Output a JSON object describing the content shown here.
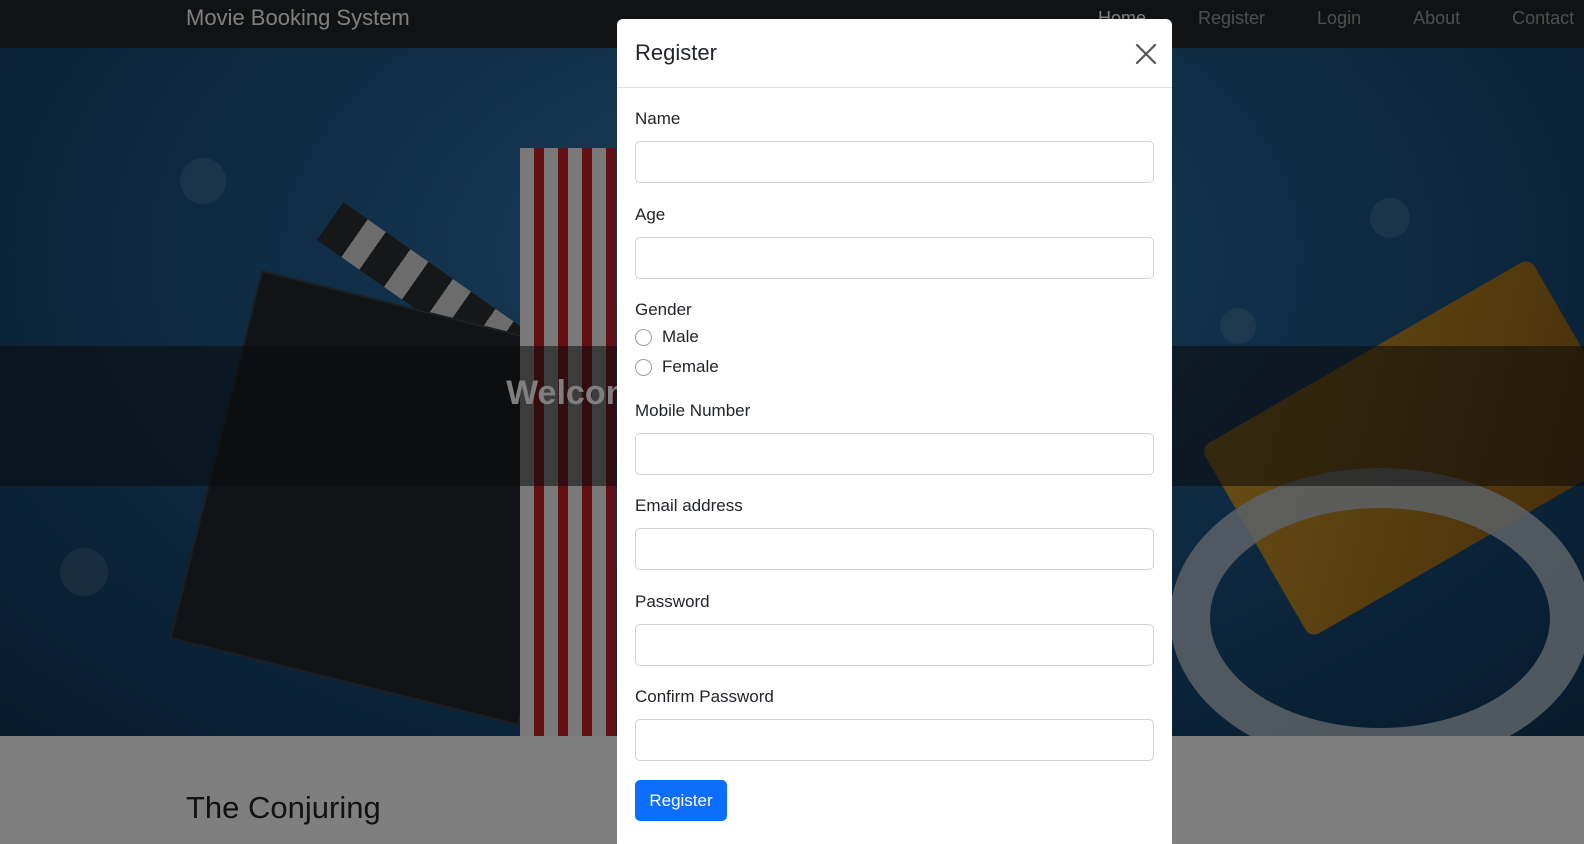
{
  "navbar": {
    "brand": "Movie Booking System",
    "items": [
      {
        "label": "Home",
        "active": true
      },
      {
        "label": "Register",
        "active": false
      },
      {
        "label": "Login",
        "active": false
      },
      {
        "label": "About",
        "active": false
      },
      {
        "label": "Contact",
        "active": false
      }
    ]
  },
  "hero": {
    "heading": "Welcome to Movie Booking System"
  },
  "content": {
    "movie_title": "The Conjuring"
  },
  "modal": {
    "title": "Register",
    "close_icon": "close-icon",
    "fields": {
      "name_label": "Name",
      "name_value": "",
      "age_label": "Age",
      "age_value": "",
      "gender_label": "Gender",
      "gender_options": [
        "Male",
        "Female"
      ],
      "mobile_label": "Mobile Number",
      "mobile_value": "",
      "email_label": "Email address",
      "email_value": "",
      "password_label": "Password",
      "password_value": "",
      "confirm_label": "Confirm Password",
      "confirm_value": ""
    },
    "submit_label": "Register",
    "accent_color": "#0d6efd"
  }
}
